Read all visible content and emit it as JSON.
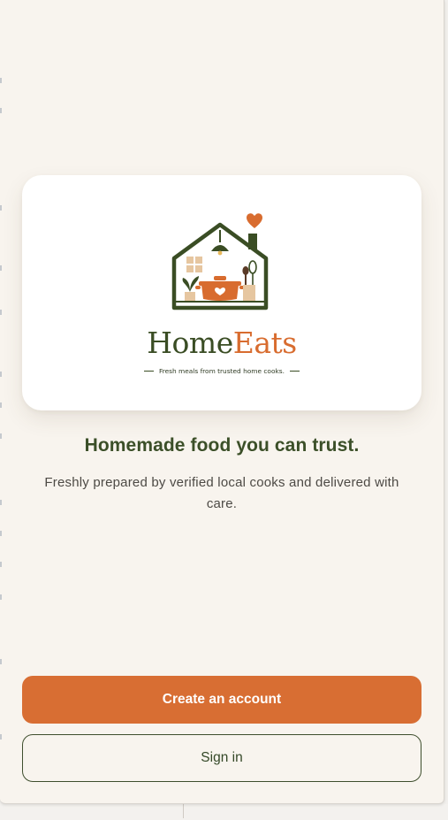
{
  "brand": {
    "name_part1": "Home",
    "name_part2": "Eats",
    "tagline": "Fresh meals from trusted home cooks.",
    "colors": {
      "green": "#3a4d24",
      "orange": "#d86c2f"
    },
    "logo_icon": "house-with-cooking-pot-icon"
  },
  "hero": {
    "headline": "Homemade food you can trust.",
    "subtext": "Freshly prepared by verified local cooks and delivered with care."
  },
  "actions": {
    "primary_label": "Create an account",
    "secondary_label": "Sign in"
  },
  "theme": {
    "background": "#f8f4ee",
    "primary": "#d86e33",
    "text_green": "#3b4f28"
  }
}
